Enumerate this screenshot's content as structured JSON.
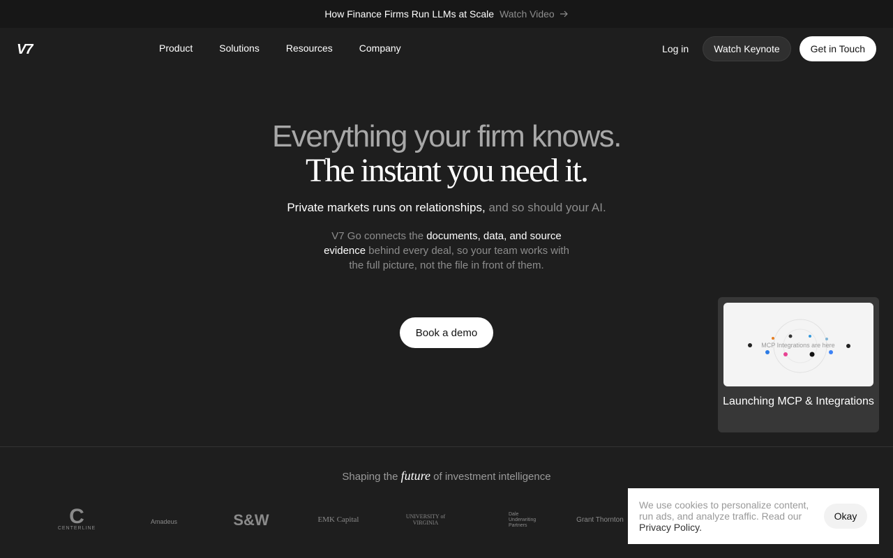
{
  "banner": {
    "title": "How Finance Firms Run LLMs at Scale",
    "link": "Watch Video"
  },
  "nav": {
    "logo": "V7",
    "items": [
      "Product",
      "Solutions",
      "Resources",
      "Company"
    ],
    "login": "Log in",
    "keynote": "Watch Keynote",
    "contact": "Get in Touch"
  },
  "hero": {
    "headline_a": "Everything your firm knows.",
    "headline_b": "The instant you need it.",
    "sub_bold": "Private markets runs on relationships,",
    "sub_gray": "and so should your AI.",
    "desc_1": "V7 Go connects the",
    "desc_2": "documents, data, and source evidence",
    "desc_3": "behind every deal, so your team works with the full picture, not the file in front of them.",
    "cta": "Book a demo"
  },
  "card": {
    "thumb_text": "MCP Integrations are here",
    "caption": "Launching MCP & Integrations"
  },
  "shaping": {
    "pre": "Shaping the",
    "em": "future",
    "post": "of investment intelligence"
  },
  "logos": [
    "CENTERLINE",
    "Amadeus",
    "S&W",
    "EMK Capital",
    "UNIVERSITY of VIRGINIA",
    "Dale Underwriting Partners",
    "Grant Thornton"
  ],
  "cookie": {
    "text": "We use cookies to personalize content, run ads, and analyze traffic. Read our",
    "link": "Privacy Policy.",
    "ok": "Okay"
  }
}
